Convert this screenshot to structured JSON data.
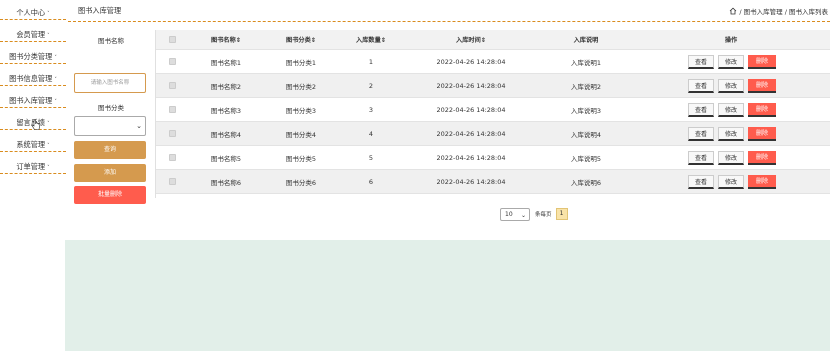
{
  "sidebar": {
    "items": [
      {
        "label": "个人中心"
      },
      {
        "label": "会员管理"
      },
      {
        "label": "图书分类管理"
      },
      {
        "label": "图书信息管理"
      },
      {
        "label": "图书入库管理"
      },
      {
        "label": "留言反馈"
      },
      {
        "label": "系统管理"
      },
      {
        "label": "订单管理"
      }
    ],
    "chevron": "˅"
  },
  "header": {
    "title": "图书入库管理",
    "breadcrumb": "/ 图书入库管理 / 图书入库列表"
  },
  "search": {
    "name_label": "图书名称",
    "name_placeholder": "请输入图书名称",
    "category_label": "图书分类",
    "query_button": "查询",
    "add_button": "添加",
    "batch_delete_button": "批量删除"
  },
  "table": {
    "headers": [
      "图书名称⇕",
      "图书分类⇕",
      "入库数量⇕",
      "入库时间⇕",
      "入库说明",
      "操作"
    ],
    "rows": [
      {
        "name": "图书名称1",
        "category": "图书分类1",
        "qty": "1",
        "time": "2022-04-26 14:28:04",
        "note": "入库说明1"
      },
      {
        "name": "图书名称2",
        "category": "图书分类2",
        "qty": "2",
        "time": "2022-04-26 14:28:04",
        "note": "入库说明2"
      },
      {
        "name": "图书名称3",
        "category": "图书分类3",
        "qty": "3",
        "time": "2022-04-26 14:28:04",
        "note": "入库说明3"
      },
      {
        "name": "图书名称4",
        "category": "图书分类4",
        "qty": "4",
        "time": "2022-04-26 14:28:04",
        "note": "入库说明4"
      },
      {
        "name": "图书名称5",
        "category": "图书分类5",
        "qty": "5",
        "time": "2022-04-26 14:28:04",
        "note": "入库说明5"
      },
      {
        "name": "图书名称6",
        "category": "图书分类6",
        "qty": "6",
        "time": "2022-04-26 14:28:04",
        "note": "入库说明6"
      }
    ],
    "actions": {
      "view": "查看",
      "edit": "修改",
      "delete": "删除"
    }
  },
  "pagination": {
    "page_size": "10",
    "per_page_label": "条每页",
    "current_page": "1"
  },
  "colors": {
    "accent": "#d59a4e",
    "danger": "#ff5c4d",
    "bottom_panel": "#e2efe9"
  }
}
